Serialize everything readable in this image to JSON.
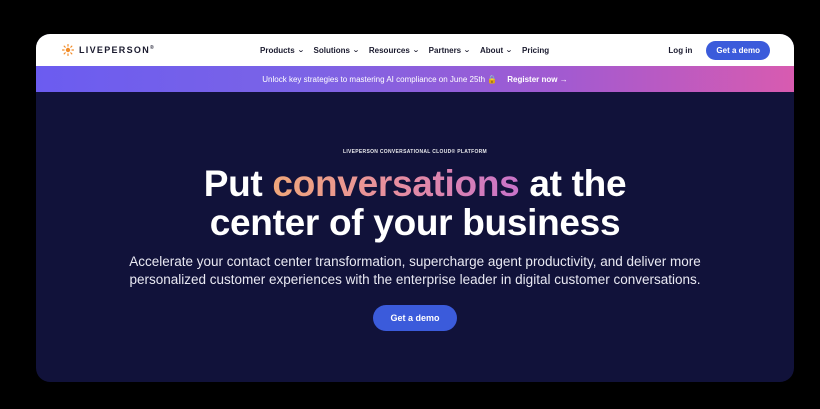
{
  "nav": {
    "logo_text": "LIVEPERSON",
    "logo_reg": "®",
    "menu": [
      {
        "label": "Products",
        "has_dropdown": true
      },
      {
        "label": "Solutions",
        "has_dropdown": true
      },
      {
        "label": "Resources",
        "has_dropdown": true
      },
      {
        "label": "Partners",
        "has_dropdown": true
      },
      {
        "label": "About",
        "has_dropdown": true
      },
      {
        "label": "Pricing",
        "has_dropdown": false
      }
    ],
    "chevron_glyph": "⌄",
    "login_label": "Log in",
    "demo_label": "Get a demo"
  },
  "banner": {
    "text": "Unlock key strategies to mastering AI compliance on June 25th 🔒",
    "cta": "Register now →"
  },
  "hero": {
    "eyebrow": "LIVEPERSON CONVERSATIONAL CLOUD® PLATFORM",
    "headline_before": "Put ",
    "headline_highlight": "conversations",
    "headline_after": " at the",
    "headline_line2": "center of your business",
    "subtext": "Accelerate your contact center transformation, supercharge agent productivity, and deliver more personalized customer experiences with the enterprise leader in digital customer conversations.",
    "cta": "Get a demo"
  },
  "colors": {
    "accent": "#3b5bdb",
    "hero_bg": "#11123a",
    "logo_orange": "#f28c28"
  }
}
